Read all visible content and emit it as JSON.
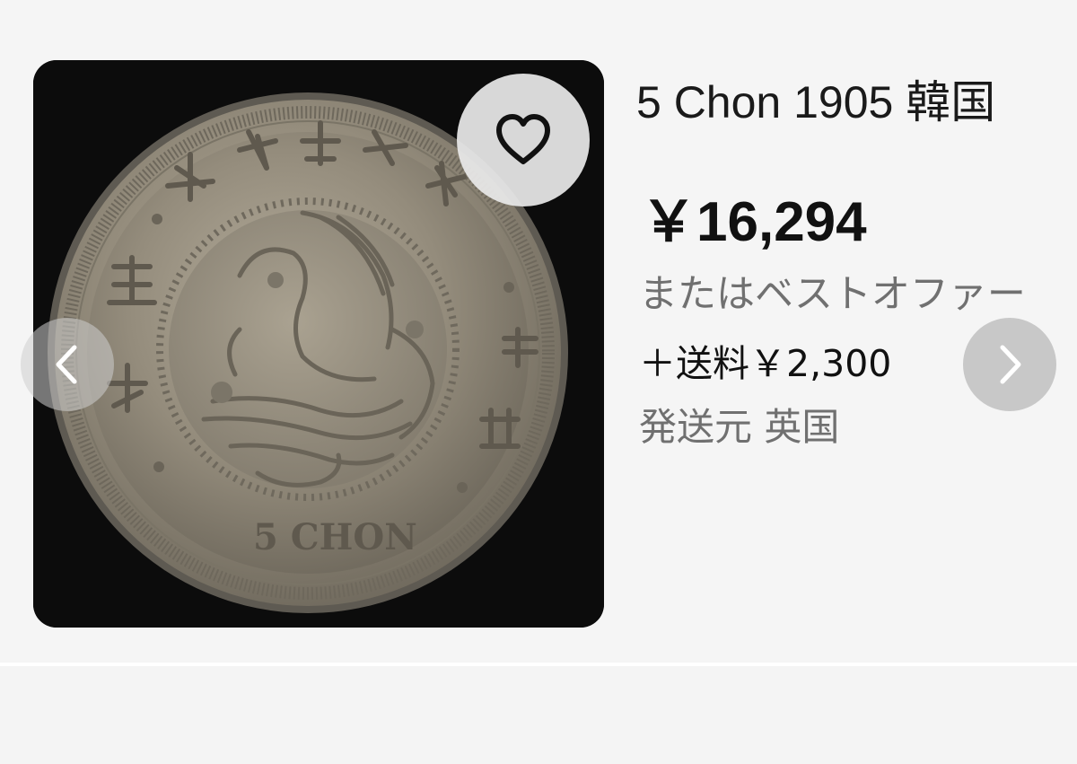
{
  "listing": {
    "title": "5 Chon 1905 韓国",
    "price": "￥16,294",
    "best_offer_text": "またはベストオファー",
    "shipping_text": "＋送料￥2,300",
    "ships_from_text": "発送元 英国"
  },
  "photo": {
    "subject": "1905 Korea 5 Chon coin with phoenix design",
    "coin_text_bottom": "5 CHON"
  },
  "icons": {
    "favorite": "heart-outline-icon",
    "previous": "chevron-left-icon",
    "next": "chevron-right-icon"
  },
  "colors": {
    "background": "#f5f5f5",
    "title_text": "#1a1a1a",
    "secondary_text": "#707070",
    "photo_background": "#0c0c0c",
    "coin_metal": "#9a9282"
  }
}
